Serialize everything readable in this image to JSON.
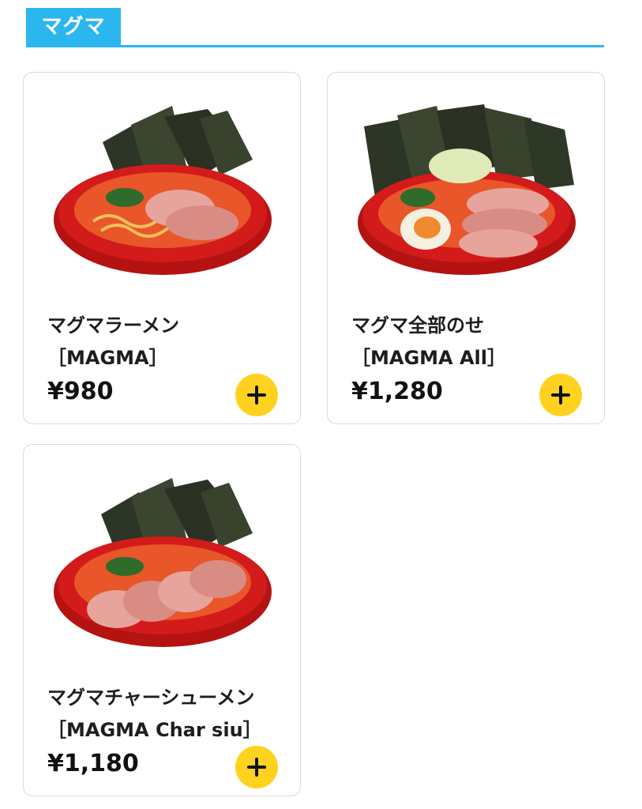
{
  "section": {
    "title": "マグマ",
    "accent_color": "#2bb6ef"
  },
  "menu_items": [
    {
      "name": "マグマラーメン",
      "subtitle": "［MAGMA］",
      "price": "¥980",
      "image": "magma-ramen-bowl"
    },
    {
      "name": "マグマ全部のせ",
      "subtitle": "［MAGMA All］",
      "price": "¥1,280",
      "image": "magma-all-toppings-bowl"
    },
    {
      "name": "マグマチャーシューメン",
      "subtitle": "［MAGMA Char siu］",
      "price": "¥1,180",
      "image": "magma-char-siu-bowl"
    }
  ],
  "add_button_color": "#ffd21f"
}
